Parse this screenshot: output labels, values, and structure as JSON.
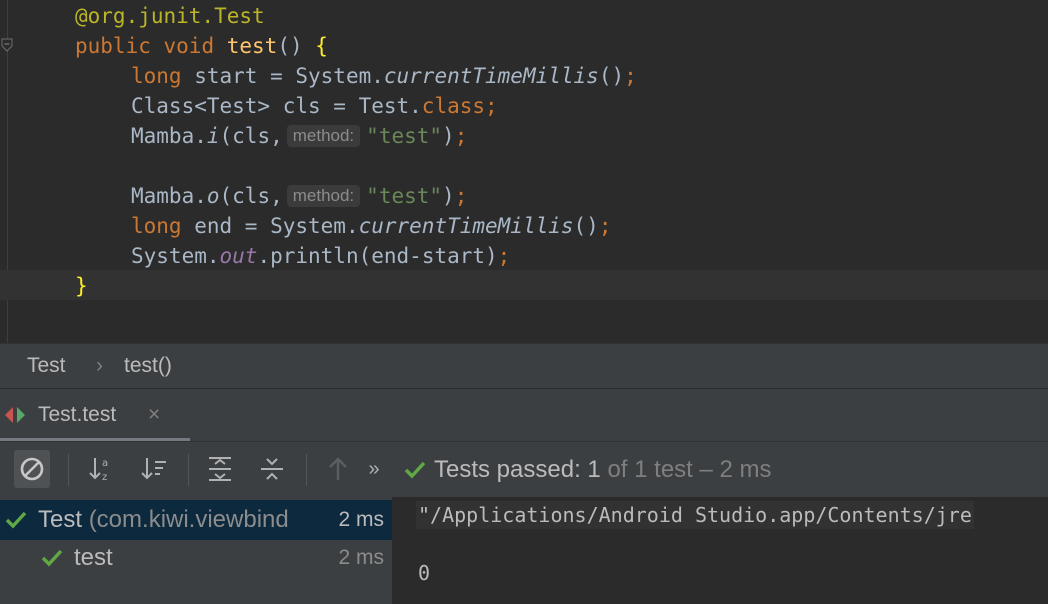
{
  "editor": {
    "line1": {
      "annotation": "@org.junit.Test"
    },
    "line2": {
      "kw_public": "public",
      "kw_void": "void",
      "method": "test",
      "parens": "()",
      "brace": "{"
    },
    "line3": {
      "kw": "long",
      "plain1": " start = System.",
      "call": "currentTimeMillis",
      "plain2": "()",
      "semi": ";"
    },
    "line4": {
      "plain1": "Class<Test> cls = Test.",
      "kw": "class",
      "semi": ";"
    },
    "line5": {
      "plain1": "Mamba.",
      "call": "i",
      "plain2": "(cls,",
      "hint": "method:",
      "str": "\"test\"",
      "plain3": ")",
      "semi": ";"
    },
    "line6": {
      "plain1": "Mamba.",
      "call": "o",
      "plain2": "(cls,",
      "hint": "method:",
      "str": "\"test\"",
      "plain3": ")",
      "semi": ";"
    },
    "line7": {
      "kw": "long",
      "plain1": " end = System.",
      "call": "currentTimeMillis",
      "plain2": "()",
      "semi": ";"
    },
    "line8": {
      "plain1": "System.",
      "field": "out",
      "plain2": ".println(end-start)",
      "semi": ";"
    },
    "line9": {
      "brace": "}"
    }
  },
  "breadcrumb": {
    "items": [
      "Test",
      "test()"
    ],
    "separator": "›"
  },
  "run_tab": {
    "label": "Test.test",
    "close": "×"
  },
  "toolbar": {
    "status_prefix": "Tests passed:",
    "passed_count": "1",
    "status_suffix": "of 1 test – 2 ms",
    "overflow": "»"
  },
  "tree": {
    "root": {
      "name": "Test",
      "package": "(com.kiwi.viewbind",
      "time": "2 ms"
    },
    "child": {
      "name": "test",
      "time": "2 ms"
    }
  },
  "console": {
    "lines": [
      "\"/Applications/Android Studio.app/Contents/jre",
      "0"
    ]
  },
  "colors": {
    "pass": "#5fa843",
    "keyword": "#cc7832",
    "string": "#6a8759",
    "method": "#ffc66d"
  }
}
